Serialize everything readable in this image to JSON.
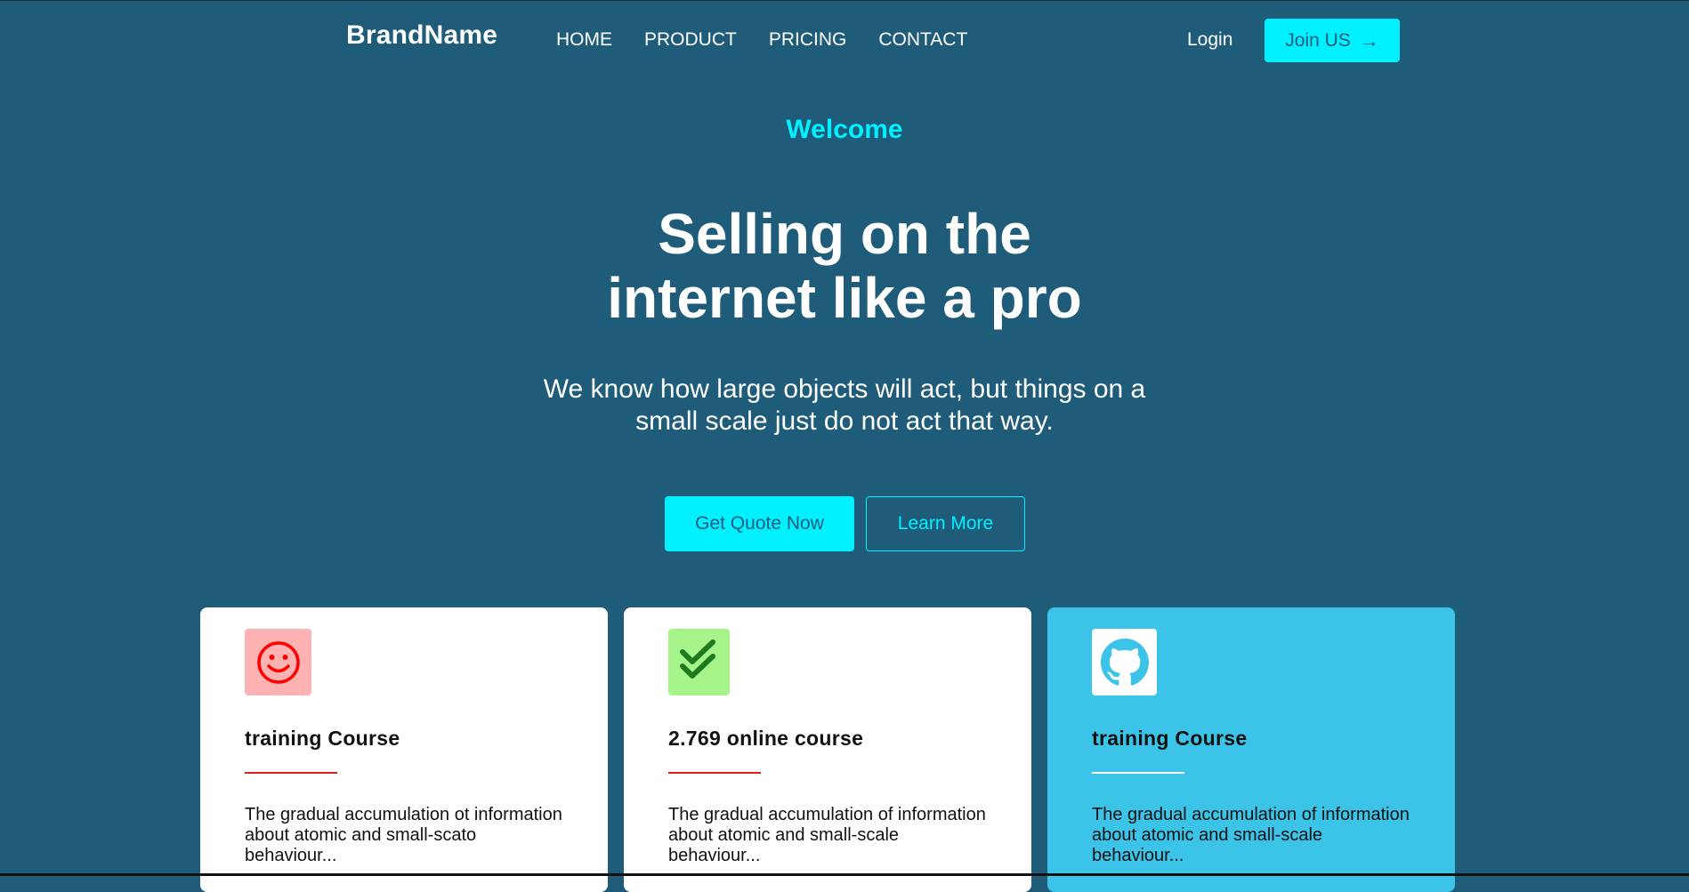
{
  "header": {
    "brand": "BrandName",
    "nav": [
      "HOME",
      "PRODUCT",
      "PRICING",
      "CONTACT"
    ],
    "login_label": "Login",
    "join_label": "Join US",
    "join_arrow": "→"
  },
  "hero": {
    "eyebrow": "Welcome",
    "title_line1": "Selling on the",
    "title_line2": "internet like a pro",
    "subtitle_line1": "We know how large objects will act, but things on a",
    "subtitle_line2": "small scale just do not act that way.",
    "primary_cta": "Get Quote Now",
    "secondary_cta": "Learn More"
  },
  "cards": [
    {
      "icon": "smiley-icon",
      "icon_color": "#ff0000",
      "icon_bg": "#ffb2b2",
      "title": "training Course",
      "text_line1": "The gradual accumulation ot information",
      "text_line2": "about atomic and small-scato",
      "text_line3": "behaviour..."
    },
    {
      "icon": "double-check-icon",
      "icon_color": "#1f7a1f",
      "icon_bg": "#a6f58a",
      "title": "2.769 online course",
      "text_line1": "The gradual accumulation of information",
      "text_line2": "about atomic and small-scale",
      "text_line3": "behaviour..."
    },
    {
      "icon": "github-icon",
      "icon_color": "#3bc4e8",
      "icon_bg": "#ffffff",
      "title": "training Course",
      "text_line1": "The gradual accumulation of information",
      "text_line2": "about atomic and small-scale",
      "text_line3": "behaviour..."
    }
  ],
  "colors": {
    "background": "#1f5c7a",
    "accent": "#00f0ff",
    "featured_card": "#3bc4e8",
    "divider_red": "#e01e1e"
  }
}
